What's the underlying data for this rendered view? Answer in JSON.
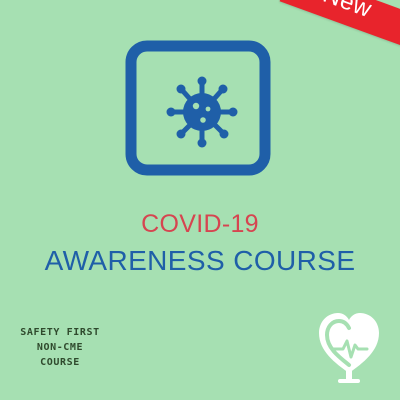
{
  "badge": {
    "label": "New",
    "color": "#e8242c"
  },
  "icon": {
    "name": "virus-icon",
    "frame_color": "#1f5fa8"
  },
  "title": {
    "line1": "COVID-19",
    "line2": "AWARENESS COURSE",
    "line1_color": "#d64550",
    "line2_color": "#1f5fa8"
  },
  "course_tag": {
    "lines": [
      "SAFETY FIRST",
      "NON-CME",
      "COURSE"
    ]
  },
  "logo": {
    "name": "heart-pulse-logo-icon"
  },
  "background_color": "#a6e0b2"
}
